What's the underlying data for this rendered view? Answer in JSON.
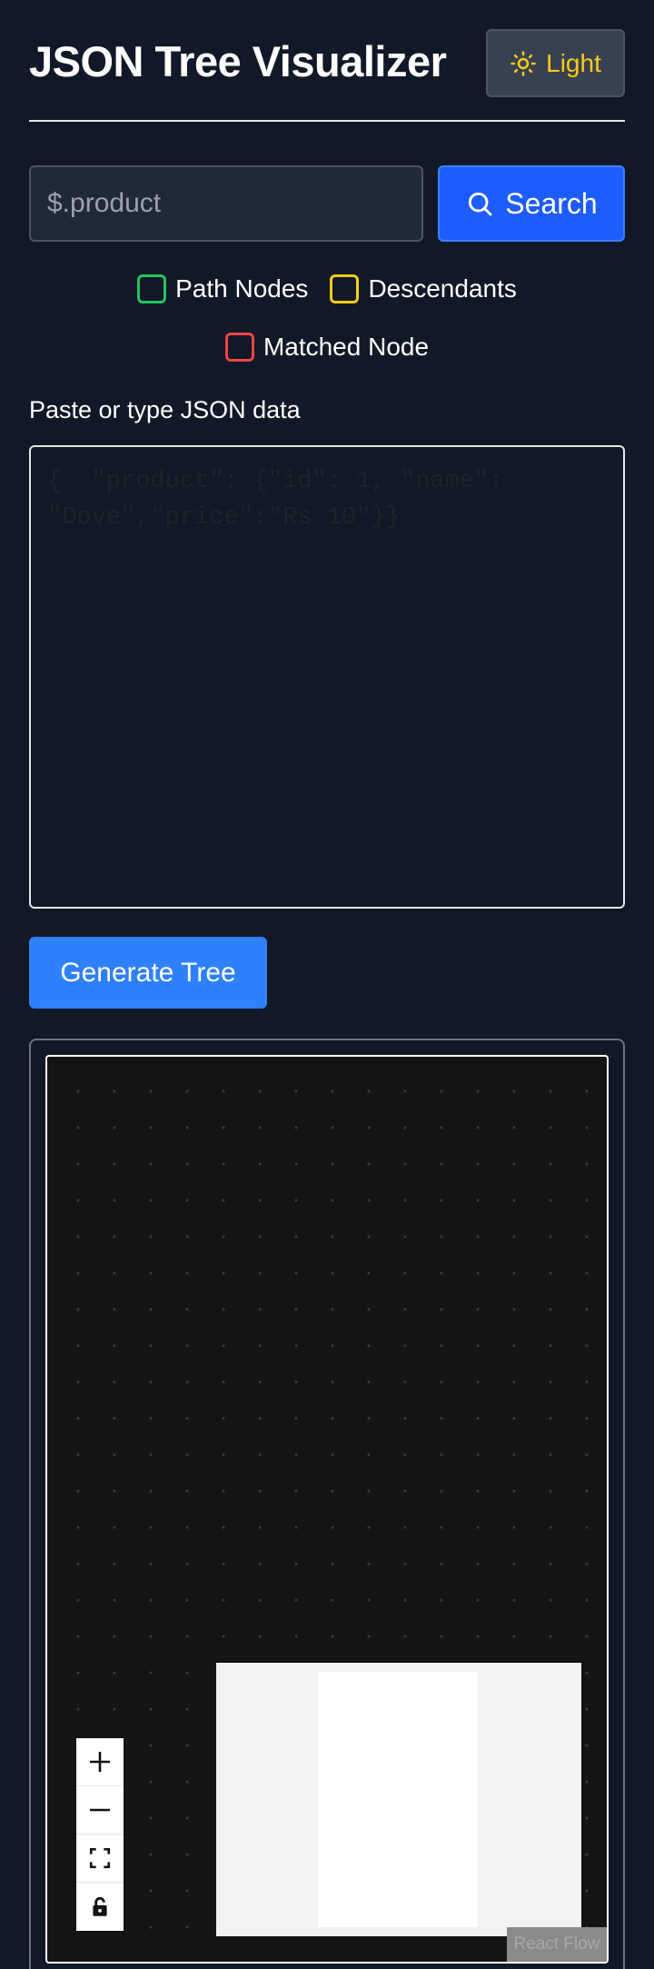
{
  "header": {
    "title": "JSON Tree Visualizer",
    "theme_toggle": {
      "label": "Light",
      "icon": "sun-icon"
    }
  },
  "search": {
    "placeholder": "$.product",
    "button_label": "Search",
    "button_icon": "search-icon"
  },
  "legend": [
    {
      "label": "Path Nodes",
      "color": "#22c55e"
    },
    {
      "label": "Descendants",
      "color": "#facc15"
    },
    {
      "label": "Matched Node",
      "color": "#ef4444"
    }
  ],
  "editor": {
    "label": "Paste or type JSON data",
    "placeholder": "{  \"product\": {\"id\": 1, \"name\": \"Dove\",\"price\":\"Rs 10\"}}",
    "value": ""
  },
  "generate_button": {
    "label": "Generate Tree"
  },
  "flow": {
    "controls": [
      "zoom-in-icon",
      "zoom-out-icon",
      "fit-view-icon",
      "lock-icon"
    ],
    "attribution": "React Flow"
  },
  "colors": {
    "background": "#111827",
    "accent": "#1d5cff",
    "generate": "#2f80ff",
    "theme_text": "#facc15"
  }
}
